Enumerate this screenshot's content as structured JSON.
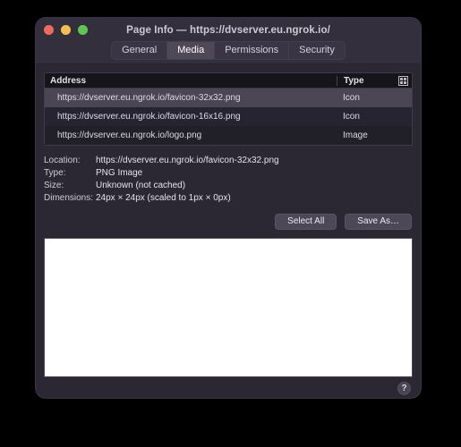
{
  "window": {
    "title": "Page Info — https://dvserver.eu.ngrok.io/",
    "traffic_lights": [
      {
        "name": "close",
        "color": "#ed6a5f"
      },
      {
        "name": "minimize",
        "color": "#f4bf50"
      },
      {
        "name": "zoom",
        "color": "#61c554"
      }
    ]
  },
  "tabs": [
    {
      "label": "General",
      "active": false
    },
    {
      "label": "Media",
      "active": true
    },
    {
      "label": "Permissions",
      "active": false
    },
    {
      "label": "Security",
      "active": false
    }
  ],
  "table": {
    "columns": [
      {
        "key": "address",
        "label": "Address"
      },
      {
        "key": "type",
        "label": "Type"
      }
    ],
    "column_picker_icon": "column-picker-icon",
    "rows": [
      {
        "address": "https://dvserver.eu.ngrok.io/favicon-32x32.png",
        "type": "Icon",
        "selected": true
      },
      {
        "address": "https://dvserver.eu.ngrok.io/favicon-16x16.png",
        "type": "Icon",
        "selected": false
      },
      {
        "address": "https://dvserver.eu.ngrok.io/logo.png",
        "type": "Image",
        "selected": false
      }
    ]
  },
  "details": [
    {
      "label": "Location:",
      "value": "https://dvserver.eu.ngrok.io/favicon-32x32.png"
    },
    {
      "label": "Type:",
      "value": "PNG Image"
    },
    {
      "label": "Size:",
      "value": "Unknown (not cached)"
    },
    {
      "label": "Dimensions:",
      "value": "24px × 24px (scaled to 1px × 0px)"
    }
  ],
  "buttons": {
    "select_all": "Select All",
    "save_as": "Save As…"
  },
  "help": {
    "glyph": "?",
    "icon": "help-icon"
  },
  "colors": {
    "window_background": "#2b2733",
    "titlebar": "#332f3c",
    "table_background": "#211f28",
    "row_selected": "#4a4653",
    "preview": "#ffffff",
    "desktop": "#000000"
  }
}
